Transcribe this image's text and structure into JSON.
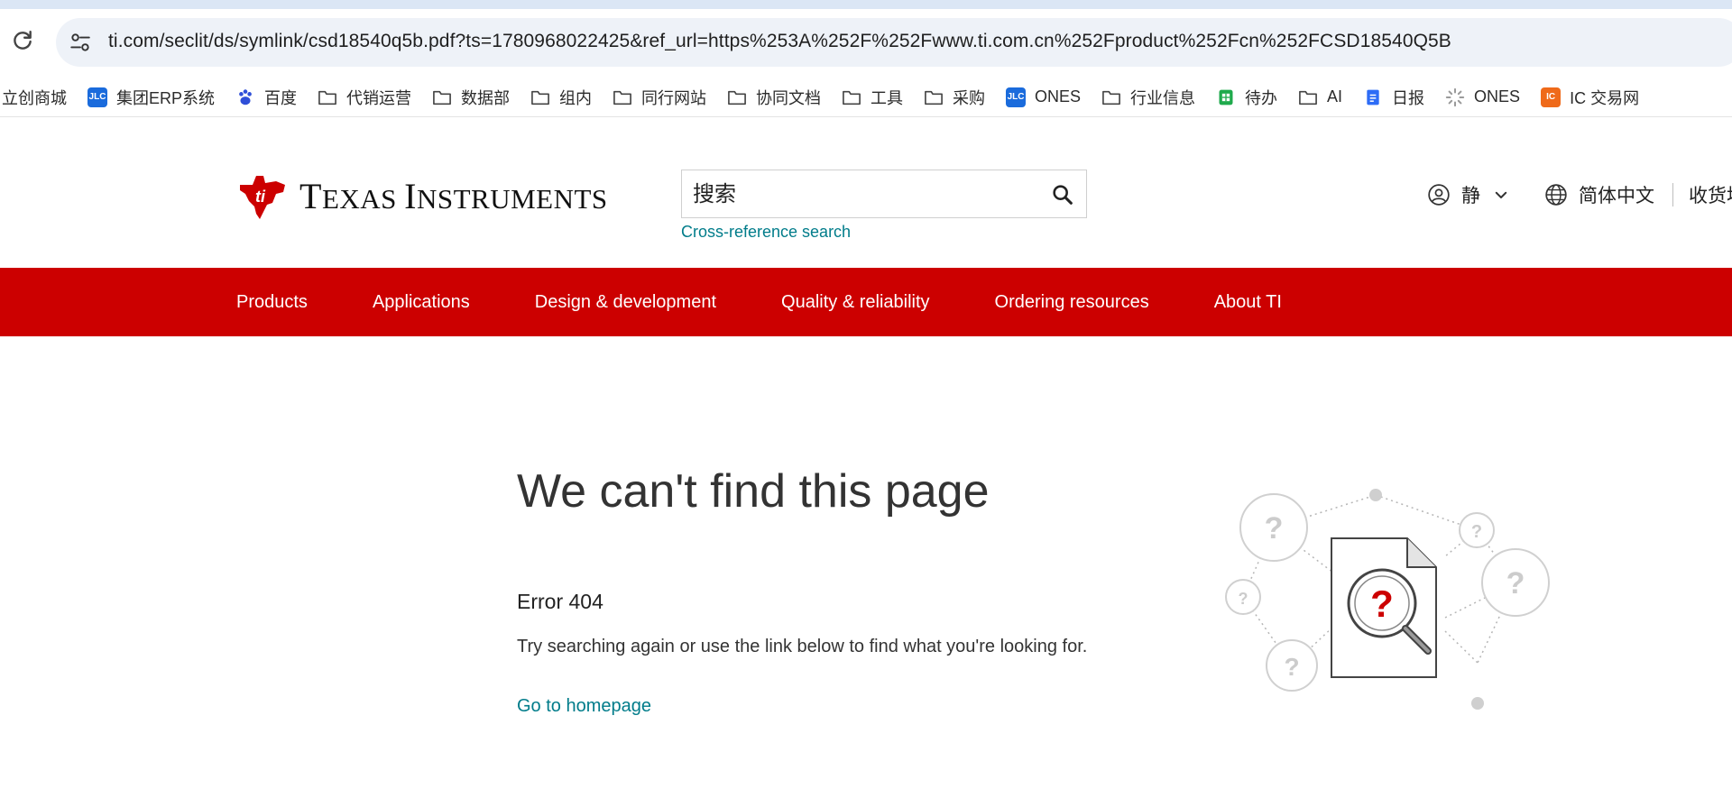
{
  "browser": {
    "url": "ti.com/seclit/ds/symlink/csd18540q5b.pdf?ts=1780968022425&ref_url=https%253A%252F%252Fwww.ti.com.cn%252Fproduct%252Fcn%252FCSD18540Q5B"
  },
  "bookmarks": [
    {
      "label": "立创商城",
      "icon": "none"
    },
    {
      "label": "集团ERP系统",
      "icon": "jlc-badge",
      "badge": "JLC"
    },
    {
      "label": "百度",
      "icon": "baidu-paw"
    },
    {
      "label": "代销运营",
      "icon": "folder"
    },
    {
      "label": "数据部",
      "icon": "folder"
    },
    {
      "label": "组内",
      "icon": "folder"
    },
    {
      "label": "同行网站",
      "icon": "folder"
    },
    {
      "label": "协同文档",
      "icon": "folder"
    },
    {
      "label": "工具",
      "icon": "folder"
    },
    {
      "label": "采购",
      "icon": "folder"
    },
    {
      "label": "ONES",
      "icon": "jlc-badge",
      "badge": "JLC"
    },
    {
      "label": "行业信息",
      "icon": "folder"
    },
    {
      "label": "待办",
      "icon": "sheet-green"
    },
    {
      "label": "AI",
      "icon": "folder"
    },
    {
      "label": "日报",
      "icon": "doc-blue"
    },
    {
      "label": "ONES",
      "icon": "spinner"
    },
    {
      "label": "IC 交易网",
      "icon": "ic-badge",
      "badge": "IC"
    }
  ],
  "header": {
    "logo_big_t": "T",
    "logo_exas": "EXAS ",
    "logo_big_i": "I",
    "logo_nstruments": "NSTRUMENTS",
    "search_placeholder": "搜索",
    "xref_label": "Cross-reference search",
    "account_name": "静",
    "language": "简体中文",
    "cart_label": "收货地"
  },
  "nav": {
    "items": [
      "Products",
      "Applications",
      "Design & development",
      "Quality & reliability",
      "Ordering resources",
      "About TI"
    ]
  },
  "error": {
    "title": "We can't find this page",
    "code": "Error 404",
    "message": "Try searching again or use the link below to find what you're looking for.",
    "home_link": "Go to homepage"
  },
  "colors": {
    "brand_red": "#cc0000",
    "link_teal": "#007c8a"
  }
}
